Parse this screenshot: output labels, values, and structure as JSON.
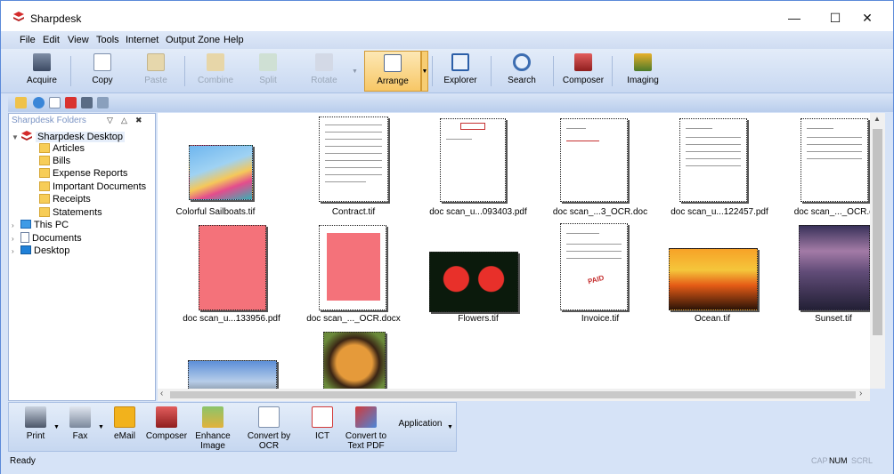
{
  "window": {
    "title": "Sharpdesk",
    "minimize": "—",
    "maximize": "☐",
    "close": "✕"
  },
  "menu": [
    "File",
    "Edit",
    "View",
    "Tools",
    "Internet",
    "Output Zone",
    "Help"
  ],
  "toolbar": [
    {
      "label": "Acquire",
      "icon": "scanner-icon",
      "enabled": true
    },
    {
      "label": "Copy",
      "icon": "copy-icon",
      "enabled": true
    },
    {
      "label": "Paste",
      "icon": "paste-icon",
      "enabled": false
    },
    {
      "label": "Combine",
      "icon": "combine-icon",
      "enabled": false
    },
    {
      "label": "Split",
      "icon": "split-icon",
      "enabled": false
    },
    {
      "label": "Rotate",
      "icon": "rotate-icon",
      "enabled": false
    },
    {
      "label": "Arrange",
      "icon": "arrange-icon",
      "enabled": true,
      "active": true
    },
    {
      "label": "Explorer",
      "icon": "explorer-icon",
      "enabled": true
    },
    {
      "label": "Search",
      "icon": "search-icon",
      "enabled": true
    },
    {
      "label": "Composer",
      "icon": "composer-icon",
      "enabled": true
    },
    {
      "label": "Imaging",
      "icon": "imaging-icon",
      "enabled": true
    }
  ],
  "folders": {
    "header": "Sharpdesk Folders",
    "root": "Sharpdesk Desktop",
    "children": [
      "Articles",
      "Bills",
      "Expense Reports",
      "Important Documents",
      "Receipts",
      "Statements"
    ],
    "others": [
      "This PC",
      "Documents",
      "Desktop"
    ]
  },
  "files": [
    {
      "name": "Colorful Sailboats.tif",
      "kind": "photo"
    },
    {
      "name": "Contract.tif",
      "kind": "doc"
    },
    {
      "name": "doc scan_u...093403.pdf",
      "kind": "doc"
    },
    {
      "name": "doc scan_...3_OCR.doc",
      "kind": "doc"
    },
    {
      "name": "doc scan_u...122457.pdf",
      "kind": "doc"
    },
    {
      "name": "doc scan_..._OCR.doc",
      "kind": "doc"
    },
    {
      "name": "doc scan_u...133956.pdf",
      "kind": "pinkdoc"
    },
    {
      "name": "doc scan_..._OCR.docx",
      "kind": "pinkdoc"
    },
    {
      "name": "Flowers.tif",
      "kind": "photo"
    },
    {
      "name": "Invoice.tif",
      "kind": "doc"
    },
    {
      "name": "Ocean.tif",
      "kind": "photo"
    },
    {
      "name": "Sunset.tif",
      "kind": "photo"
    }
  ],
  "actions": [
    {
      "label": "Print",
      "icon": "printer-icon"
    },
    {
      "label": "Fax",
      "icon": "fax-icon"
    },
    {
      "label": "eMail",
      "icon": "email-icon"
    },
    {
      "label": "Composer",
      "icon": "composer-icon"
    },
    {
      "label": "Enhance Image",
      "icon": "enhance-image-icon"
    },
    {
      "label": "Convert by OCR",
      "icon": "ocr-icon"
    },
    {
      "label": "ICT",
      "icon": "ict-icon"
    },
    {
      "label": "Convert to Text PDF",
      "icon": "text-pdf-icon"
    },
    {
      "label": "Application",
      "icon": "application-icon"
    }
  ],
  "status": {
    "text": "Ready",
    "cap": "CAP",
    "num": "NUM",
    "scrl": "SCRL"
  }
}
